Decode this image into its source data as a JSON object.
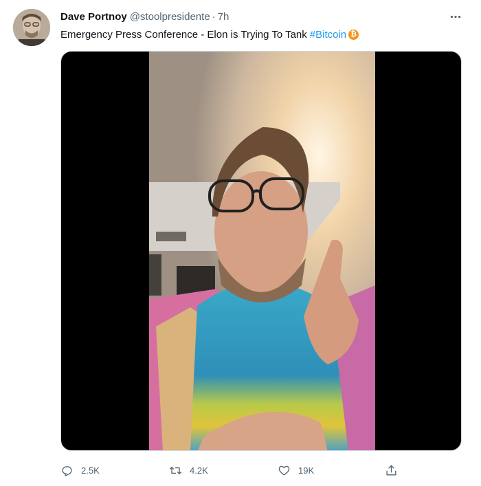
{
  "tweet": {
    "author": {
      "display_name": "Dave Portnoy",
      "handle": "@stoolpresidente",
      "separator": "·",
      "time": "7h",
      "avatar_icon": "profile-photo"
    },
    "text": "Emergency Press Conference - Elon is Trying To Tank",
    "hashtag": "#Bitcoin",
    "emoji": "₿",
    "media": {
      "type": "video",
      "description_icon": "video-thumbnail"
    },
    "actions": {
      "reply": {
        "icon": "reply-icon",
        "count": "2.5K"
      },
      "retweet": {
        "icon": "retweet-icon",
        "count": "4.2K"
      },
      "like": {
        "icon": "heart-icon",
        "count": "19K"
      },
      "share": {
        "icon": "share-icon"
      }
    },
    "colors": {
      "hashtag": "#1d9bf0",
      "secondary_text": "#536471",
      "primary_text": "#0f1419",
      "bitcoin": "#f7931a"
    }
  }
}
